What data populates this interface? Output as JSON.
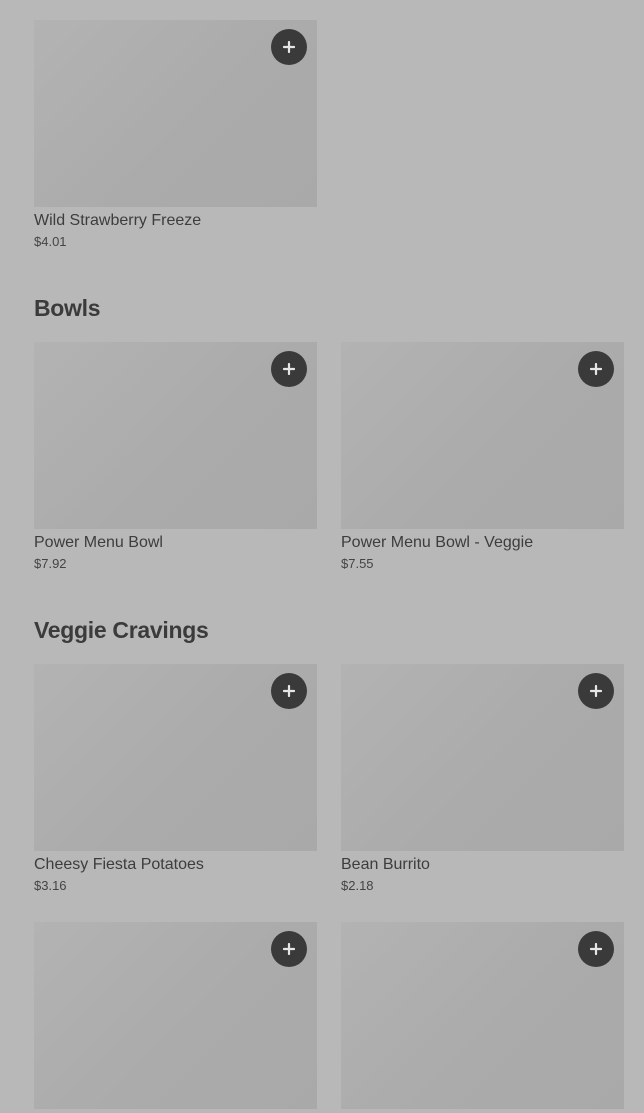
{
  "top_item": {
    "name": "Wild Strawberry Freeze",
    "price": "$4.01",
    "add_icon": "plus-icon"
  },
  "sections": [
    {
      "title": "Bowls",
      "items": [
        {
          "name": "Power Menu Bowl",
          "price": "$7.92"
        },
        {
          "name": "Power Menu Bowl - Veggie",
          "price": "$7.55"
        }
      ]
    },
    {
      "title": "Veggie Cravings",
      "items": [
        {
          "name": "Cheesy Fiesta Potatoes",
          "price": "$3.16"
        },
        {
          "name": "Bean Burrito",
          "price": "$2.18"
        },
        {
          "name": "",
          "price": ""
        },
        {
          "name": "",
          "price": ""
        }
      ]
    }
  ],
  "colors": {
    "background": "#b8b8b8",
    "image_placeholder": "#aeaeae",
    "add_button": "#3a3a3a",
    "add_icon": "#e6e6e6",
    "text": "#3a3a3a"
  }
}
